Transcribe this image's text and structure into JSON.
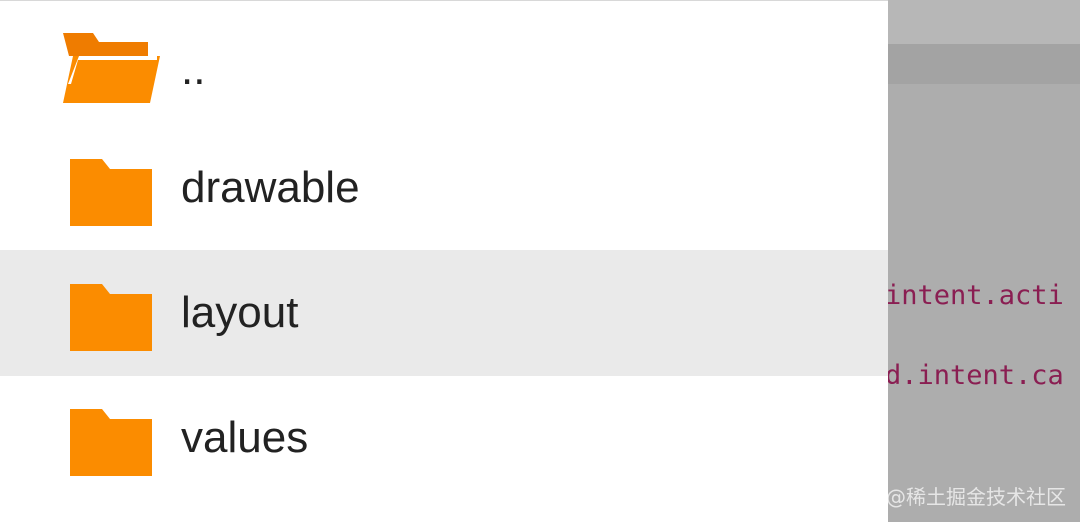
{
  "file_list": {
    "items": [
      {
        "label": "..",
        "icon": "folder-open-icon",
        "selected": false
      },
      {
        "label": "drawable",
        "icon": "folder-icon",
        "selected": false
      },
      {
        "label": "layout",
        "icon": "folder-icon",
        "selected": true
      },
      {
        "label": "values",
        "icon": "folder-icon",
        "selected": false
      }
    ],
    "folder_color": "#fb8c00",
    "selected_row_color": "#eaeaea"
  },
  "background_app": {
    "code_lines": [
      "intent.acti",
      "d.intent.ca"
    ],
    "code_color": "#8a1e52"
  },
  "watermark": {
    "text": "@稀土掘金技术社区"
  }
}
